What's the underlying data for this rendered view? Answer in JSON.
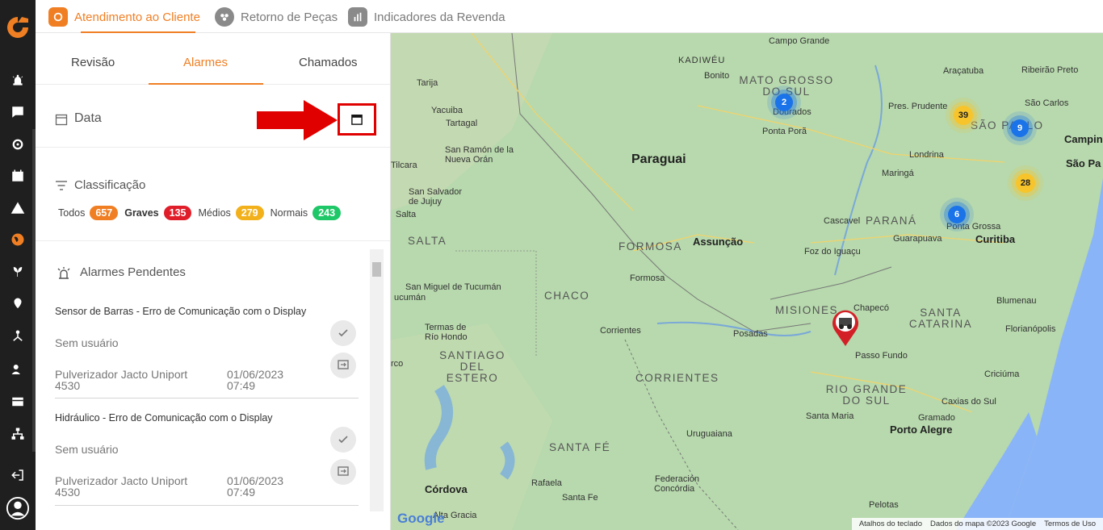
{
  "top_tabs": [
    {
      "label": "Atendimento ao Cliente",
      "active": true
    },
    {
      "label": "Retorno de Peças",
      "active": false
    },
    {
      "label": "Indicadores da Revenda",
      "active": false
    }
  ],
  "sub_tabs": [
    {
      "label": "Revisão"
    },
    {
      "label": "Alarmes",
      "active": true
    },
    {
      "label": "Chamados"
    }
  ],
  "filters": {
    "date_label": "Data",
    "classification_label": "Classificação",
    "chips": [
      {
        "label": "Todos",
        "count": "657",
        "color": "#f07f24"
      },
      {
        "label": "Graves",
        "count": "135",
        "color": "#e01e2a"
      },
      {
        "label": "Médios",
        "count": "279",
        "color": "#f2b01a"
      },
      {
        "label": "Normais",
        "count": "243",
        "color": "#1ec767"
      }
    ]
  },
  "pending": {
    "title": "Alarmes Pendentes",
    "alarms": [
      {
        "title": "Sensor de Barras - Erro de Comunicação com o Display",
        "user": "Sem usuário",
        "machine": "Pulverizador Jacto Uniport 4530",
        "date": "01/06/2023",
        "time": "07:49"
      },
      {
        "title": "Hidráulico - Erro de Comunicação com o Display",
        "user": "Sem usuário",
        "machine": "Pulverizador Jacto Uniport 4530",
        "date": "01/06/2023",
        "time": "07:49"
      }
    ]
  },
  "map": {
    "labels": {
      "paraguai": "Paraguai",
      "assuncao": "Assunção",
      "formosa_r": "FORMOSA",
      "chaco": "CHACO",
      "santiago": "SANTIAGO DEL ESTERO",
      "corrientes_r": "CORRIENTES",
      "santa_fe": "SANTA FÉ",
      "salta": "SALTA",
      "misiones": "MISIONES",
      "parana": "PARANÁ",
      "santa_catarina": "SANTA CATARINA",
      "rgs": "RIO GRANDE DO SUL",
      "mato_grosso": "MATO GROSSO DO SUL",
      "sao_paulo": "SÃO PAULO",
      "kadiweu": "KADIWÉU",
      "curitiba": "Curitiba",
      "porto_alegre": "Porto Alegre",
      "cordoba": "Córdova",
      "campo_grande": "Campo Grande",
      "bonito": "Bonito",
      "dourados": "Dourados",
      "ponta_pora": "Ponta Porã",
      "aracatuba": "Araçatuba",
      "ribeirao": "Ribeirão Preto",
      "sao_carlos": "São Carlos",
      "campinas": "Campinas",
      "sao_paulo_city": "São Pa",
      "pres_prudente": "Pres. Prudente",
      "londrina": "Londrina",
      "maringa": "Maringá",
      "cascavel": "Cascavel",
      "guarapuava": "Guarapuava",
      "ponta_grossa": "Ponta Grossa",
      "foz": "Foz do Iguaçu",
      "chapeco": "Chapecó",
      "blumenau": "Blumenau",
      "florianopolis": "Florianópolis",
      "passo_fundo": "Passo Fundo",
      "criciuma": "Criciúma",
      "caxias": "Caxias do Sul",
      "gramado": "Gramado",
      "santa_maria": "Santa Maria",
      "pelotas": "Pelotas",
      "uruguaiana": "Uruguaiana",
      "posadas": "Posadas",
      "corrientes": "Corrientes",
      "formosa": "Formosa",
      "tarija": "Tarija",
      "yacuiba": "Yacuiba",
      "tartagal": "Tartagal",
      "san_ramon": "San Ramón de la Nueva Orán",
      "tilcara": "Tilcara",
      "san_salvador": "San Salvador de Jujuy",
      "san_miguel": "San Miguel de Tucumán",
      "termas": "Termas de Río Hondo",
      "rafaela": "Rafaela",
      "santa_fe_c": "Santa Fe",
      "federacion": "Federación",
      "concordia": "Concórdia",
      "alta_gracia": "Alta Gracia",
      "rco": "rco",
      "ucuman": "ucumán",
      "salta_c": "Salta"
    },
    "clusters": [
      {
        "count": "2",
        "kind": "blue"
      },
      {
        "count": "39",
        "kind": "yellow"
      },
      {
        "count": "9",
        "kind": "blue"
      },
      {
        "count": "28",
        "kind": "yellow"
      },
      {
        "count": "6",
        "kind": "blue"
      }
    ],
    "footer": {
      "shortcuts": "Atalhos do teclado",
      "data": "Dados do mapa ©2023 Google",
      "terms": "Termos de Uso"
    },
    "google": "Google"
  }
}
